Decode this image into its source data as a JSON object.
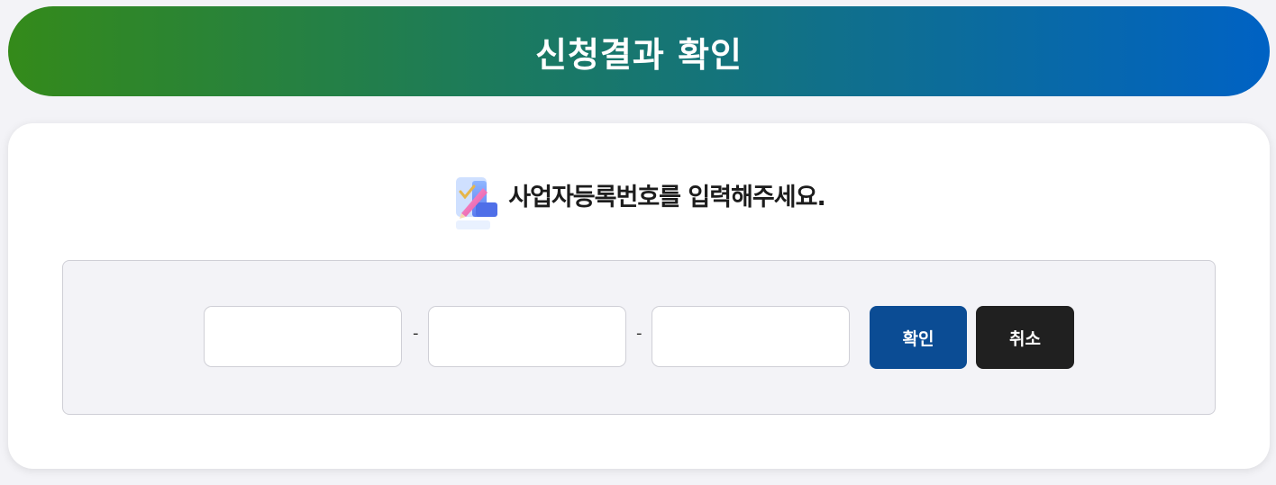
{
  "header": {
    "title": "신청결과 확인"
  },
  "prompt": {
    "icon": "checklist-pencil-icon",
    "text": "사업자등록번호를 입력해주세요."
  },
  "form": {
    "field1": {
      "value": "",
      "placeholder": ""
    },
    "field2": {
      "value": "",
      "placeholder": ""
    },
    "field3": {
      "value": "",
      "placeholder": ""
    },
    "separator": "-",
    "confirm_label": "확인",
    "cancel_label": "취소"
  },
  "colors": {
    "gradient_start": "#348a1a",
    "gradient_end": "#0062c4",
    "confirm_button": "#0b4c94",
    "cancel_button": "#202020"
  }
}
